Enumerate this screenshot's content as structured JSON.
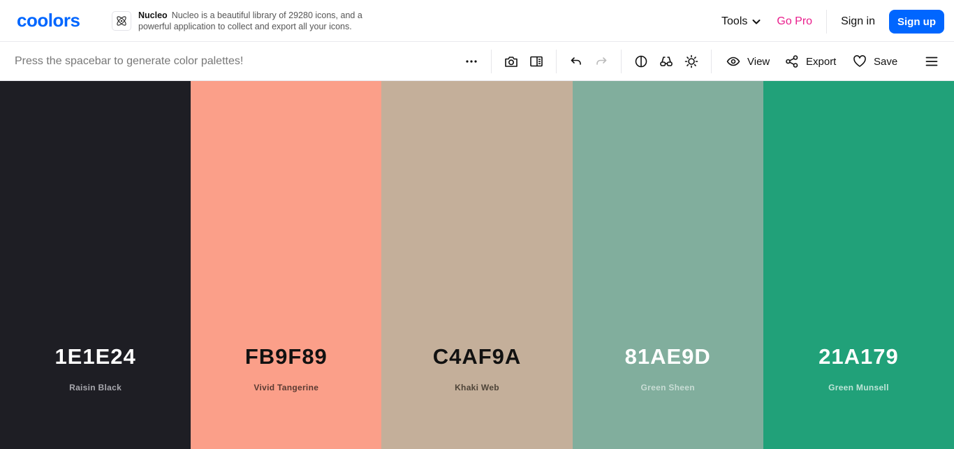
{
  "header": {
    "logo_text": "coolors",
    "ad": {
      "brand": "Nucleo",
      "text": "Nucleo is a beautiful library of 29280 icons, and a powerful application to collect and export all your icons."
    },
    "tools_label": "Tools",
    "gopro_label": "Go Pro",
    "signin_label": "Sign in",
    "signup_label": "Sign up"
  },
  "toolbar": {
    "hint": "Press the spacebar to generate color palettes!",
    "view_label": "View",
    "export_label": "Export",
    "save_label": "Save"
  },
  "palette": {
    "colors": [
      {
        "hex": "1E1E24",
        "name": "Raisin Black",
        "bg": "#1e1e24",
        "text_color": "#ffffff",
        "name_color": "#a8a8ae"
      },
      {
        "hex": "FB9F89",
        "name": "Vivid Tangerine",
        "bg": "#fb9f89",
        "text_color": "#111111",
        "name_color": "#5a3a32"
      },
      {
        "hex": "C4AF9A",
        "name": "Khaki Web",
        "bg": "#c4af9a",
        "text_color": "#111111",
        "name_color": "#4e4438"
      },
      {
        "hex": "81AE9D",
        "name": "Green Sheen",
        "bg": "#81ae9d",
        "text_color": "#ffffff",
        "name_color": "#c9ddd5"
      },
      {
        "hex": "21A179",
        "name": "Green Munsell",
        "bg": "#21a179",
        "text_color": "#ffffff",
        "name_color": "#bfe5d8"
      }
    ]
  },
  "colors": {
    "accent": "#0066ff",
    "gopro": "#e91e8c"
  },
  "icons": [
    "nucleo-atom-icon",
    "chevron-down-icon",
    "more-icon",
    "camera-icon",
    "sidebar-icon",
    "undo-icon",
    "redo-icon",
    "contrast-icon",
    "glasses-icon",
    "sun-icon",
    "eye-icon",
    "share-icon",
    "heart-icon",
    "menu-icon"
  ]
}
